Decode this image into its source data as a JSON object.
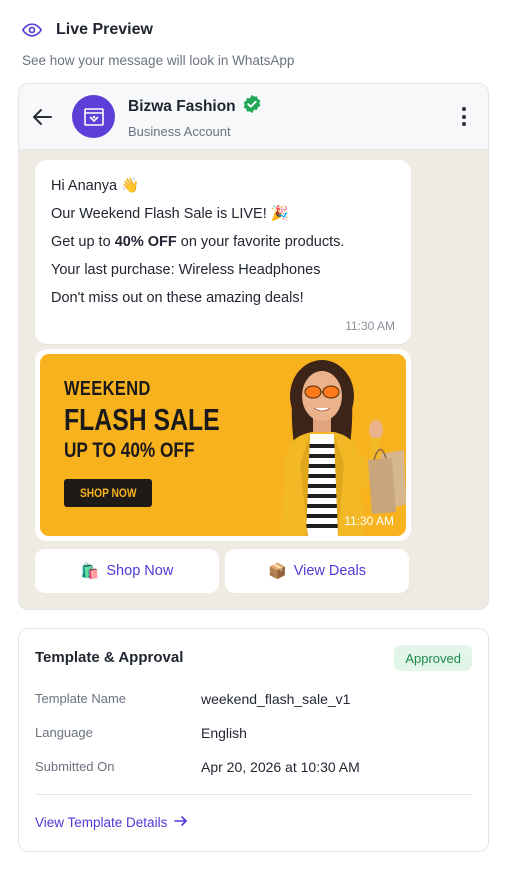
{
  "header": {
    "title": "Live Preview",
    "subtitle": "See how your message will look in WhatsApp",
    "icon": "eye-icon",
    "accent": "#5b3fd6"
  },
  "chat": {
    "business_name": "Bizwa Fashion",
    "business_subtitle": "Business Account",
    "verified_color": "#1fa855",
    "avatar_color": "#5b3fd6",
    "message": {
      "line1": "Hi Ananya 👋",
      "line2": "Our Weekend Flash Sale is LIVE! 🎉",
      "line3_pre": "Get up to ",
      "line3_bold": "40% OFF",
      "line3_post": " on your favorite products.",
      "line4": "Your last purchase: Wireless Headphones",
      "line5": "Don't miss out on these amazing deals!",
      "time": "11:30 AM"
    },
    "banner": {
      "line1": "WEEKEND",
      "line2": "FLASH SALE",
      "line3": "UP TO 40% OFF",
      "button": "SHOP NOW",
      "time": "11:30 AM",
      "bg_color": "#f7b21e"
    },
    "actions": [
      {
        "icon": "🛍️",
        "label": "Shop Now"
      },
      {
        "icon": "📦",
        "label": "View Deals"
      }
    ]
  },
  "approval": {
    "title": "Template & Approval",
    "status": "Approved",
    "rows": [
      {
        "key": "Template Name",
        "value": "weekend_flash_sale_v1"
      },
      {
        "key": "Language",
        "value": "English"
      },
      {
        "key": "Submitted On",
        "value": "Apr 20, 2026 at 10:30 AM"
      }
    ],
    "link": "View Template Details",
    "link_icon": "arrow-right-icon"
  }
}
